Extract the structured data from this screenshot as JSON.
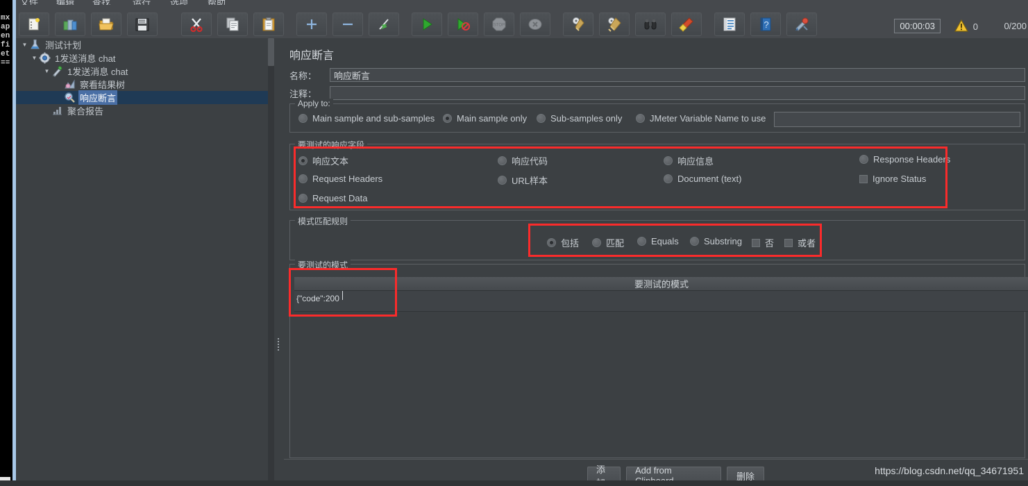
{
  "window": {
    "menu_items": [
      "文件",
      "编辑",
      "查找",
      "运行",
      "选项",
      "帮助"
    ]
  },
  "toolbar": {
    "buttons": [
      {
        "name": "new-test-plan",
        "icon": "new-document-icon"
      },
      {
        "name": "open-templates",
        "icon": "templates-book-icon"
      },
      {
        "name": "open-file",
        "icon": "open-folder-icon"
      },
      {
        "name": "save-test-plan",
        "icon": "floppy-save-icon"
      },
      {
        "name": "cut",
        "icon": "scissors-icon"
      },
      {
        "name": "copy",
        "icon": "copy-pages-icon"
      },
      {
        "name": "paste",
        "icon": "clipboard-paste-icon"
      },
      {
        "name": "expand-all",
        "icon": "plus-icon"
      },
      {
        "name": "collapse-all",
        "icon": "minus-icon"
      },
      {
        "name": "toggle-enabled",
        "icon": "toggle-bolt-icon"
      },
      {
        "name": "start",
        "icon": "play-green-icon"
      },
      {
        "name": "start-no-timers",
        "icon": "play-no-timers-icon"
      },
      {
        "name": "stop",
        "icon": "stop-sign-icon"
      },
      {
        "name": "shutdown",
        "icon": "shutdown-x-icon"
      },
      {
        "name": "clear",
        "icon": "broom-gear-icon"
      },
      {
        "name": "clear-all",
        "icon": "broom-gear-all-icon"
      },
      {
        "name": "search",
        "icon": "binoculars-icon"
      },
      {
        "name": "reset-search",
        "icon": "yellow-brush-icon"
      },
      {
        "name": "function-helper",
        "icon": "notebook-list-icon"
      },
      {
        "name": "help",
        "icon": "help-book-icon"
      },
      {
        "name": "templates-extra",
        "icon": "paint-tools-icon"
      }
    ],
    "timer": "00:00:03",
    "warning_count": "0",
    "thread_count": "0/200"
  },
  "tree": {
    "nodes": [
      {
        "label": "测试计划",
        "icon": "test-plan-flask-icon",
        "indent": 0,
        "expanded": true,
        "selected": false
      },
      {
        "label": "1发送消息 chat",
        "icon": "thread-group-gear-icon",
        "indent": 1,
        "expanded": true,
        "selected": false
      },
      {
        "label": "1发送消息 chat",
        "icon": "sampler-pipette-icon",
        "indent": 2,
        "expanded": true,
        "selected": false
      },
      {
        "label": "察看结果树",
        "icon": "view-results-tree-icon",
        "indent": 3,
        "expanded": null,
        "selected": false
      },
      {
        "label": "响应断言",
        "icon": "assertion-magnifier-icon",
        "indent": 3,
        "expanded": null,
        "selected": true
      },
      {
        "label": "聚合报告",
        "icon": "aggregate-report-icon",
        "indent": 2,
        "expanded": null,
        "selected": false
      }
    ]
  },
  "assertion": {
    "title": "响应断言",
    "name_label": "名称：",
    "name_value": "响应断言",
    "comment_label": "注释：",
    "comment_value": "",
    "apply_to": {
      "legend": "Apply to:",
      "options": [
        {
          "label": "Main sample and sub-samples",
          "selected": false
        },
        {
          "label": "Main sample only",
          "selected": true
        },
        {
          "label": "Sub-samples only",
          "selected": false
        },
        {
          "label": "JMeter Variable Name to use",
          "selected": false
        }
      ],
      "variable_value": ""
    },
    "response_field": {
      "legend": "要测试的响应字段",
      "col1": [
        {
          "label": "响应文本",
          "type": "radio",
          "selected": true
        },
        {
          "label": "Request Headers",
          "type": "radio",
          "selected": false
        },
        {
          "label": "Request Data",
          "type": "radio",
          "selected": false
        }
      ],
      "col2": [
        {
          "label": "响应代码",
          "type": "radio",
          "selected": false
        },
        {
          "label": "URL样本",
          "type": "radio",
          "selected": false
        }
      ],
      "col3": [
        {
          "label": "响应信息",
          "type": "radio",
          "selected": false
        },
        {
          "label": "Document (text)",
          "type": "radio",
          "selected": false
        }
      ],
      "col4": [
        {
          "label": "Response Headers",
          "type": "radio",
          "selected": false
        },
        {
          "label": "Ignore Status",
          "type": "checkbox",
          "selected": false
        }
      ]
    },
    "pattern_rules": {
      "legend": "模式匹配规则",
      "options": [
        {
          "label": "包括",
          "type": "radio",
          "selected": true
        },
        {
          "label": "匹配",
          "type": "radio",
          "selected": false
        },
        {
          "label": "Equals",
          "type": "radio",
          "selected": false
        },
        {
          "label": "Substring",
          "type": "radio",
          "selected": false
        },
        {
          "label": "否",
          "type": "checkbox",
          "selected": false
        },
        {
          "label": "或者",
          "type": "checkbox",
          "selected": false
        }
      ]
    },
    "patterns": {
      "legend": "要测试的模式",
      "column_header": "要测试的模式",
      "rows": [
        "{\"code\":200"
      ]
    },
    "buttons": {
      "add": "添加",
      "add_from_clipboard": "Add from Clipboard",
      "delete": "删除"
    }
  },
  "terminal_strip": {
    "lines": [
      "mx",
      "ap",
      "en",
      "fi",
      "et",
      "=="
    ]
  },
  "watermark": "https://blog.csdn.net/qq_34671951",
  "colors": {
    "panel_bg": "#3c4043",
    "toolbar_bg": "#46494d",
    "accent_red": "#fa2b2b",
    "selection_blue": "#4a6fa5",
    "text": "#c8cdd2"
  }
}
